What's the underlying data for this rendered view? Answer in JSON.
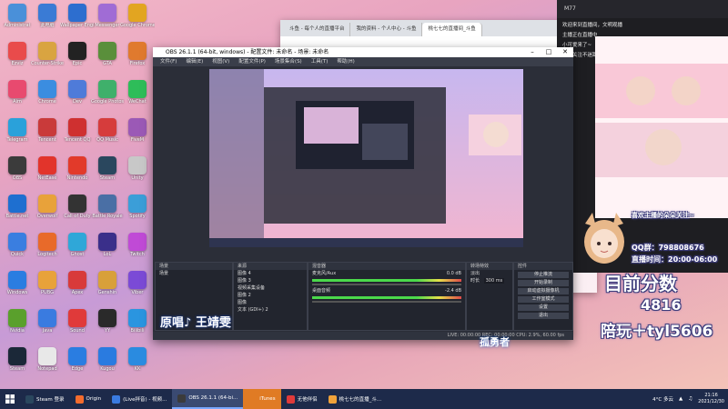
{
  "desktop_icons": [
    {
      "label": "Administrat",
      "color": "#4a90d9"
    },
    {
      "label": "此电脑",
      "color": "#3a7bd5"
    },
    {
      "label": "Wallpaper Engine",
      "color": "#2d6ecf"
    },
    {
      "label": "Messenger",
      "color": "#a06cd5"
    },
    {
      "label": "Google Chrome",
      "color": "#e2a521"
    },
    {
      "label": "Ezviz",
      "color": "#e94b4b"
    },
    {
      "label": "Counter-Strike",
      "color": "#d9a441"
    },
    {
      "label": "Epic",
      "color": "#222222"
    },
    {
      "label": "GTA",
      "color": "#5a8f3b"
    },
    {
      "label": "Firefox",
      "color": "#e07a2e"
    },
    {
      "label": "Aim",
      "color": "#e84a6f"
    },
    {
      "label": "Chrome",
      "color": "#3b8de0"
    },
    {
      "label": "Dev",
      "color": "#4f7bd9"
    },
    {
      "label": "Google Photos",
      "color": "#3fb06b"
    },
    {
      "label": "WeChat",
      "color": "#2ebd59"
    },
    {
      "label": "Telegram",
      "color": "#2aa1da"
    },
    {
      "label": "Tencent",
      "color": "#c93a3a"
    },
    {
      "label": "Tencent QQ",
      "color": "#cf3030"
    },
    {
      "label": "QQ Music",
      "color": "#d63c3c"
    },
    {
      "label": "FiveM",
      "color": "#9b59b6"
    },
    {
      "label": "OBS",
      "color": "#3b3b3b"
    },
    {
      "label": "NetEase",
      "color": "#e2342b"
    },
    {
      "label": "Nintendo",
      "color": "#e23a2a"
    },
    {
      "label": "Steam",
      "color": "#2a475e"
    },
    {
      "label": "Unity",
      "color": "#c8c8c8"
    },
    {
      "label": "Battle.net",
      "color": "#1e6fd0"
    },
    {
      "label": "Overwolf",
      "color": "#e8a23a"
    },
    {
      "label": "Call of Duty",
      "color": "#333333"
    },
    {
      "label": "Battle Royale",
      "color": "#4a6fa5"
    },
    {
      "label": "Spotify",
      "color": "#3b9ed8"
    },
    {
      "label": "Quick",
      "color": "#3a7ee0"
    },
    {
      "label": "Logitech",
      "color": "#e86a2a"
    },
    {
      "label": "Ghost",
      "color": "#2fa7d8"
    },
    {
      "label": "LoL",
      "color": "#3a2f8a"
    },
    {
      "label": "Twitch",
      "color": "#c04ad6"
    },
    {
      "label": "Windows",
      "color": "#2a7de1"
    },
    {
      "label": "PUBG",
      "color": "#e8a23a"
    },
    {
      "label": "Apex",
      "color": "#d83a3a"
    },
    {
      "label": "Genshin",
      "color": "#d8a03a"
    },
    {
      "label": "Viber",
      "color": "#7b4ad6"
    },
    {
      "label": "Nvidia",
      "color": "#5aa02c"
    },
    {
      "label": "Java",
      "color": "#3a7be0"
    },
    {
      "label": "Sound",
      "color": "#e03a3a"
    },
    {
      "label": "YY",
      "color": "#2a2a2a"
    },
    {
      "label": "Bilibili",
      "color": "#2a95e0"
    },
    {
      "label": "Steam",
      "color": "#1b2838"
    },
    {
      "label": "Notepad",
      "color": "#e8e8e8"
    },
    {
      "label": "Edge",
      "color": "#2a7de1"
    },
    {
      "label": "Kugou",
      "color": "#2a7be0"
    },
    {
      "label": "KK",
      "color": "#2a8be0"
    }
  ],
  "browser": {
    "tabs": [
      "斗鱼 - 每个人的直播平台",
      "我的资料 - 个人中心 - 斗鱼",
      "桃七七的直播间_斗鱼"
    ]
  },
  "chat": {
    "title": "M77",
    "lines": [
      "欢迎来到直播间，文明观播",
      "主播正在直播中",
      "小可爱来了~",
      "点点关注不迷路"
    ]
  },
  "obs": {
    "title": "OBS 26.1.1 (64-bit, windows) - 配置文件: 未命名 - 场景: 未命名",
    "menu": [
      "文件(F)",
      "编辑(E)",
      "视图(V)",
      "配置文件(P)",
      "场景集合(S)",
      "工具(T)",
      "帮助(H)"
    ],
    "docks": {
      "scenes": {
        "header": "场景",
        "items": [
          "场景"
        ]
      },
      "sources": {
        "header": "来源",
        "items": [
          "图像 4",
          "图像 3",
          "视频采集设备",
          "图像 2",
          "图像",
          "文本 (GDI+) 2"
        ]
      },
      "mixer": {
        "header": "混音器",
        "tracks": [
          {
            "name": "麦克风/Aux",
            "level": "0.0 dB"
          },
          {
            "name": "桌面音频",
            "level": "-2.4 dB"
          }
        ]
      },
      "transitions": {
        "header": "转场特效",
        "type": "淡出",
        "duration_label": "时长",
        "duration": "300 ms"
      },
      "controls": {
        "header": "控件",
        "buttons": [
          "停止推流",
          "开始录制",
          "启动虚拟摄像机",
          "工作室模式",
          "设置",
          "退出"
        ]
      }
    },
    "status": "LIVE: 00:00:00   REC: 00:00:00   CPU: 2.9%, 60.00 fps"
  },
  "overlay": {
    "score_label": "目前分数",
    "score_value": "4816",
    "contact": "陪玩＋tyl5606",
    "caption": "原唱♪  王靖雯",
    "subtitle": "孤勇者",
    "thanks": "喜欢主播的朵朵关注~",
    "qq_label": "QQ群：798808676",
    "schedule": "直播时间：20:00-06:00"
  },
  "taskbar": {
    "items": [
      {
        "label": "Steam 登录",
        "color": "#2a475e",
        "active": false
      },
      {
        "label": "Origin",
        "color": "#f56c2d",
        "active": false
      },
      {
        "label": "(Live拌音) - 视频...",
        "color": "#3a7be0",
        "active": false
      },
      {
        "label": "OBS 26.1.1 (64-bi...",
        "color": "#3b3b3b",
        "active": true
      },
      {
        "label": "iTunes",
        "color": "#e07b24",
        "active": false,
        "orange": true
      },
      {
        "label": "无他伴侣",
        "color": "#e03a3a",
        "active": false
      },
      {
        "label": "桃七七的直播_斗...",
        "color": "#f0a23a",
        "active": false
      }
    ],
    "weather": "4°C 多云",
    "time": "21:16",
    "date": "2021/12/30"
  }
}
